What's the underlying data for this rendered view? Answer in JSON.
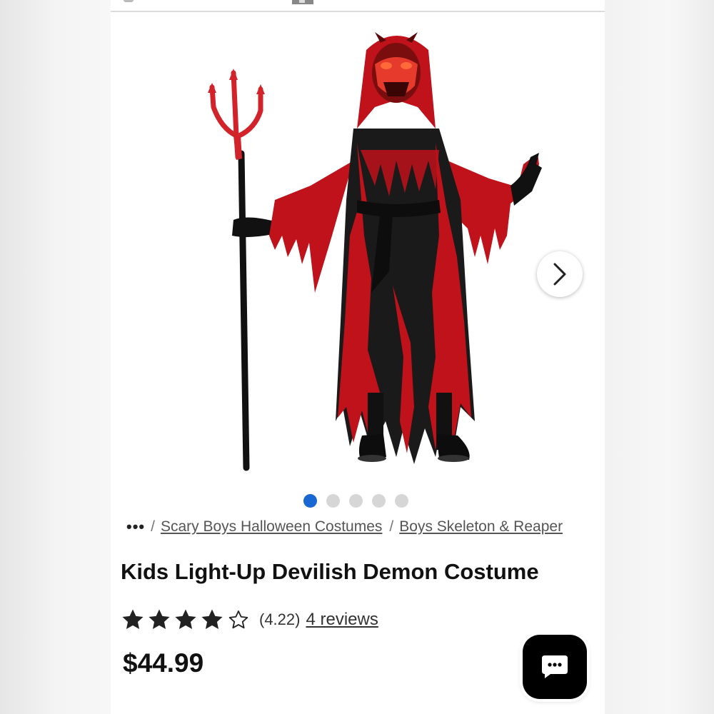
{
  "colors": {
    "accent_dot": "#1967d2",
    "costume_red": "#c0121a",
    "costume_black": "#1a1a1a"
  },
  "icons": {
    "next": "chevron-right-icon",
    "chat": "chat-bubble-icon",
    "star_full": "star-filled-icon",
    "star_empty": "star-outline-icon"
  },
  "carousel": {
    "total_slides": 5,
    "active_index": 0
  },
  "breadcrumb": {
    "ellipsis": "•••",
    "separator": "/",
    "items": [
      "Scary Boys Halloween Costumes",
      "Boys Skeleton & Reaper"
    ]
  },
  "product": {
    "title": "Kids Light-Up Devilish Demon Costume",
    "rating_value": 4.22,
    "rating_text": "(4.22)",
    "stars_filled": 4,
    "stars_total": 5,
    "reviews_link": "4 reviews",
    "price": "$44.99"
  }
}
